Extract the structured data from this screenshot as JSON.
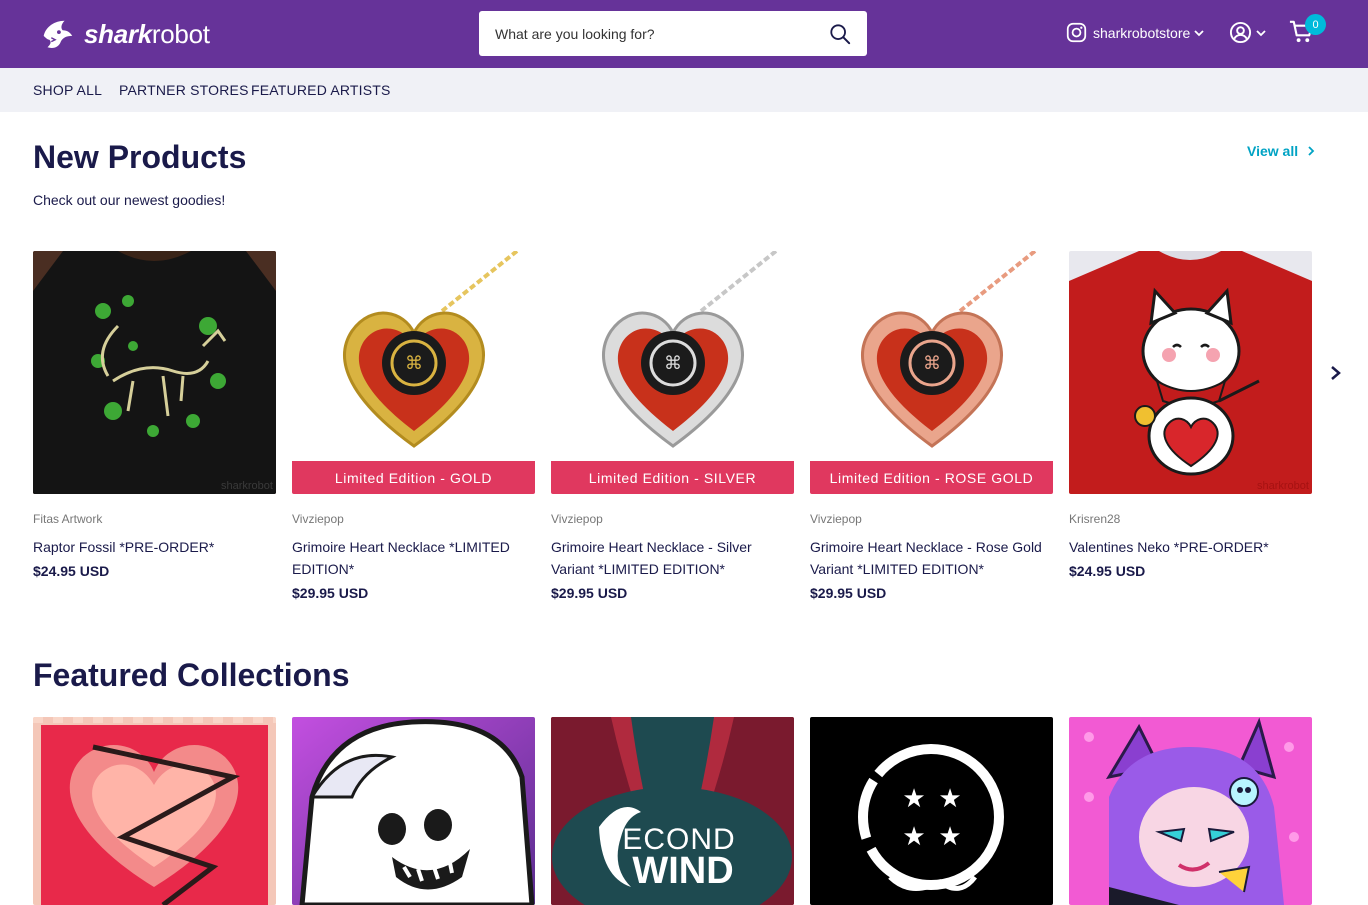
{
  "header": {
    "logo_bold": "shark",
    "logo_light": "robot",
    "search_placeholder": "What are you looking for?",
    "instagram_label": "sharkrobotstore",
    "cart_count": "0",
    "brand_color": "#663399",
    "badge_color": "#00badb"
  },
  "nav": {
    "items": [
      "SHOP ALL",
      "PARTNER STORES",
      "FEATURED ARTISTS"
    ]
  },
  "new_products": {
    "title": "New Products",
    "subtitle": "Check out our newest goodies!",
    "view_all": "View all",
    "products": [
      {
        "vendor": "Fitas Artwork",
        "title": "Raptor Fossil *PRE-ORDER*",
        "price": "$24.95 USD",
        "ribbon": "",
        "watermark": "sharkrobot"
      },
      {
        "vendor": "Vivziepop",
        "title": "Grimoire Heart Necklace *LIMITED EDITION*",
        "price": "$29.95 USD",
        "ribbon": "Limited Edition - GOLD"
      },
      {
        "vendor": "Vivziepop",
        "title": "Grimoire Heart Necklace - Silver Variant *LIMITED EDITION*",
        "price": "$29.95 USD",
        "ribbon": "Limited Edition - SILVER"
      },
      {
        "vendor": "Vivziepop",
        "title": "Grimoire Heart Necklace - Rose Gold Variant *LIMITED EDITION*",
        "price": "$29.95 USD",
        "ribbon": "Limited Edition - ROSE GOLD"
      },
      {
        "vendor": "Krisren28",
        "title": "Valentines Neko *PRE-ORDER*",
        "price": "$24.95 USD",
        "ribbon": "",
        "watermark": "sharkrobot"
      }
    ]
  },
  "featured_collections": {
    "title": "Featured Collections",
    "collection_art_text": {
      "second": "ECOND",
      "wind": "WIND"
    }
  }
}
